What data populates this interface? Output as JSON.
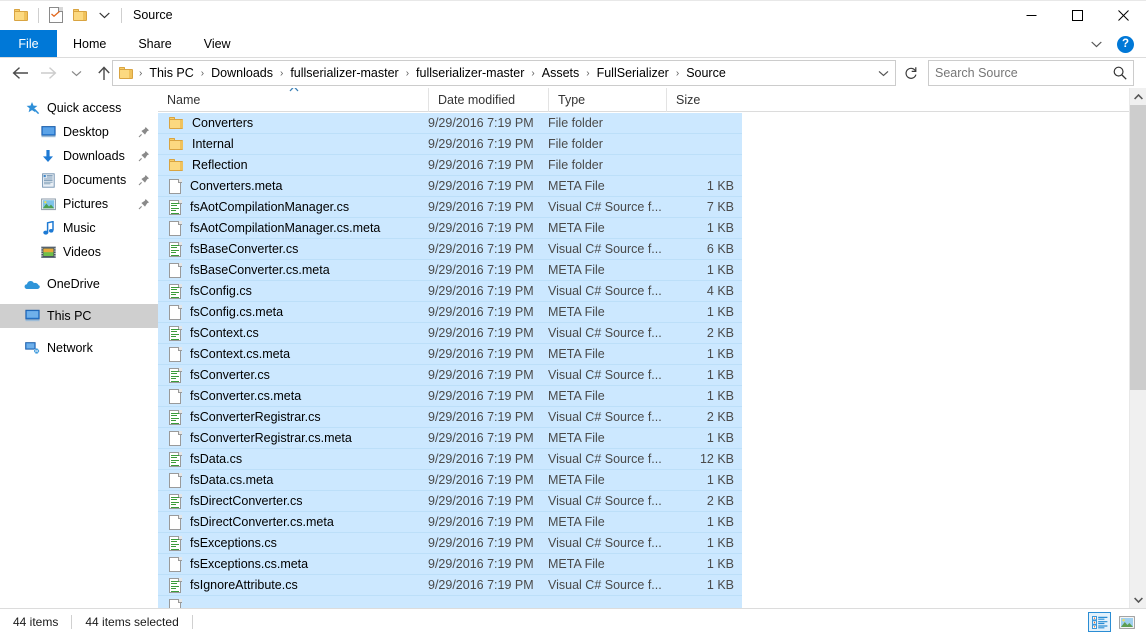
{
  "window": {
    "title": "Source",
    "quick_access": [
      {
        "name": "folder-icon",
        "label": "Properties"
      },
      {
        "name": "new-folder-icon",
        "label": "New folder"
      },
      {
        "name": "customize-chevron-icon",
        "label": "Customize Quick Access Toolbar"
      }
    ],
    "controls": {
      "minimize": "—",
      "maximize": "□",
      "close": "✕"
    }
  },
  "ribbon": {
    "tabs": [
      {
        "label": "File",
        "active": true
      },
      {
        "label": "Home",
        "active": false
      },
      {
        "label": "Share",
        "active": false
      },
      {
        "label": "View",
        "active": false
      }
    ],
    "expand_label": "ˇ",
    "help_label": "?"
  },
  "address": {
    "back_label": "Back",
    "forward_label": "Forward",
    "recent_label": "Recent locations",
    "up_label": "Up",
    "crumbs": [
      "This PC",
      "Downloads",
      "fullserializer-master",
      "fullserializer-master",
      "Assets",
      "FullSerializer",
      "Source"
    ],
    "separator": "›",
    "dropdown_label": "ˇ",
    "refresh_label": "↺"
  },
  "search": {
    "placeholder": "Search Source",
    "value": "",
    "icon": "search-icon"
  },
  "sidebar": {
    "items": [
      {
        "label": "Quick access",
        "icon": "star-pin-icon",
        "level": 0,
        "pinned": false,
        "selected": false
      },
      {
        "label": "Desktop",
        "icon": "desktop-icon",
        "level": 1,
        "pinned": true,
        "selected": false
      },
      {
        "label": "Downloads",
        "icon": "downloads-icon",
        "level": 1,
        "pinned": true,
        "selected": false
      },
      {
        "label": "Documents",
        "icon": "documents-icon",
        "level": 1,
        "pinned": true,
        "selected": false
      },
      {
        "label": "Pictures",
        "icon": "pictures-icon",
        "level": 1,
        "pinned": true,
        "selected": false
      },
      {
        "label": "Music",
        "icon": "music-icon",
        "level": 1,
        "pinned": false,
        "selected": false
      },
      {
        "label": "Videos",
        "icon": "videos-icon",
        "level": 1,
        "pinned": false,
        "selected": false
      },
      {
        "label": "OneDrive",
        "icon": "onedrive-cloud-icon",
        "level": 0,
        "pinned": false,
        "selected": false
      },
      {
        "label": "This PC",
        "icon": "this-pc-icon",
        "level": 0,
        "pinned": false,
        "selected": true
      },
      {
        "label": "Network",
        "icon": "network-icon",
        "level": 0,
        "pinned": false,
        "selected": false
      }
    ]
  },
  "file_list": {
    "columns": [
      {
        "key": "name",
        "label": "Name",
        "sorted": "asc"
      },
      {
        "key": "date",
        "label": "Date modified",
        "sorted": null
      },
      {
        "key": "type",
        "label": "Type",
        "sorted": null
      },
      {
        "key": "size",
        "label": "Size",
        "sorted": null
      }
    ],
    "rows": [
      {
        "name": "Converters",
        "date": "9/29/2016 7:19 PM",
        "type": "File folder",
        "size": "",
        "icon": "folder-icon",
        "selected": true
      },
      {
        "name": "Internal",
        "date": "9/29/2016 7:19 PM",
        "type": "File folder",
        "size": "",
        "icon": "folder-icon",
        "selected": true
      },
      {
        "name": "Reflection",
        "date": "9/29/2016 7:19 PM",
        "type": "File folder",
        "size": "",
        "icon": "folder-icon",
        "selected": true
      },
      {
        "name": "Converters.meta",
        "date": "9/29/2016 7:19 PM",
        "type": "META File",
        "size": "1 KB",
        "icon": "meta-file-icon",
        "selected": true
      },
      {
        "name": "fsAotCompilationManager.cs",
        "date": "9/29/2016 7:19 PM",
        "type": "Visual C# Source f...",
        "size": "7 KB",
        "icon": "cs-file-icon",
        "selected": true
      },
      {
        "name": "fsAotCompilationManager.cs.meta",
        "date": "9/29/2016 7:19 PM",
        "type": "META File",
        "size": "1 KB",
        "icon": "meta-file-icon",
        "selected": true
      },
      {
        "name": "fsBaseConverter.cs",
        "date": "9/29/2016 7:19 PM",
        "type": "Visual C# Source f...",
        "size": "6 KB",
        "icon": "cs-file-icon",
        "selected": true
      },
      {
        "name": "fsBaseConverter.cs.meta",
        "date": "9/29/2016 7:19 PM",
        "type": "META File",
        "size": "1 KB",
        "icon": "meta-file-icon",
        "selected": true
      },
      {
        "name": "fsConfig.cs",
        "date": "9/29/2016 7:19 PM",
        "type": "Visual C# Source f...",
        "size": "4 KB",
        "icon": "cs-file-icon",
        "selected": true
      },
      {
        "name": "fsConfig.cs.meta",
        "date": "9/29/2016 7:19 PM",
        "type": "META File",
        "size": "1 KB",
        "icon": "meta-file-icon",
        "selected": true
      },
      {
        "name": "fsContext.cs",
        "date": "9/29/2016 7:19 PM",
        "type": "Visual C# Source f...",
        "size": "2 KB",
        "icon": "cs-file-icon",
        "selected": true
      },
      {
        "name": "fsContext.cs.meta",
        "date": "9/29/2016 7:19 PM",
        "type": "META File",
        "size": "1 KB",
        "icon": "meta-file-icon",
        "selected": true
      },
      {
        "name": "fsConverter.cs",
        "date": "9/29/2016 7:19 PM",
        "type": "Visual C# Source f...",
        "size": "1 KB",
        "icon": "cs-file-icon",
        "selected": true
      },
      {
        "name": "fsConverter.cs.meta",
        "date": "9/29/2016 7:19 PM",
        "type": "META File",
        "size": "1 KB",
        "icon": "meta-file-icon",
        "selected": true
      },
      {
        "name": "fsConverterRegistrar.cs",
        "date": "9/29/2016 7:19 PM",
        "type": "Visual C# Source f...",
        "size": "2 KB",
        "icon": "cs-file-icon",
        "selected": true
      },
      {
        "name": "fsConverterRegistrar.cs.meta",
        "date": "9/29/2016 7:19 PM",
        "type": "META File",
        "size": "1 KB",
        "icon": "meta-file-icon",
        "selected": true
      },
      {
        "name": "fsData.cs",
        "date": "9/29/2016 7:19 PM",
        "type": "Visual C# Source f...",
        "size": "12 KB",
        "icon": "cs-file-icon",
        "selected": true
      },
      {
        "name": "fsData.cs.meta",
        "date": "9/29/2016 7:19 PM",
        "type": "META File",
        "size": "1 KB",
        "icon": "meta-file-icon",
        "selected": true
      },
      {
        "name": "fsDirectConverter.cs",
        "date": "9/29/2016 7:19 PM",
        "type": "Visual C# Source f...",
        "size": "2 KB",
        "icon": "cs-file-icon",
        "selected": true
      },
      {
        "name": "fsDirectConverter.cs.meta",
        "date": "9/29/2016 7:19 PM",
        "type": "META File",
        "size": "1 KB",
        "icon": "meta-file-icon",
        "selected": true
      },
      {
        "name": "fsExceptions.cs",
        "date": "9/29/2016 7:19 PM",
        "type": "Visual C# Source f...",
        "size": "1 KB",
        "icon": "cs-file-icon",
        "selected": true
      },
      {
        "name": "fsExceptions.cs.meta",
        "date": "9/29/2016 7:19 PM",
        "type": "META File",
        "size": "1 KB",
        "icon": "meta-file-icon",
        "selected": true
      },
      {
        "name": "fsIgnoreAttribute.cs",
        "date": "9/29/2016 7:19 PM",
        "type": "Visual C# Source f...",
        "size": "1 KB",
        "icon": "cs-file-icon",
        "selected": true
      }
    ]
  },
  "status": {
    "item_count": "44 items",
    "selected_count": "44 items selected",
    "views": [
      {
        "name": "details-view",
        "label": "Details view",
        "active": true
      },
      {
        "name": "large-icons-view",
        "label": "Large icons view",
        "active": false
      }
    ]
  },
  "colors": {
    "accent": "#0078d7",
    "selection": "#cce8ff",
    "selection_border": "#bcdff9",
    "sidebar_selected": "#cfcfcf",
    "folder_yellow": "#fcd980"
  }
}
